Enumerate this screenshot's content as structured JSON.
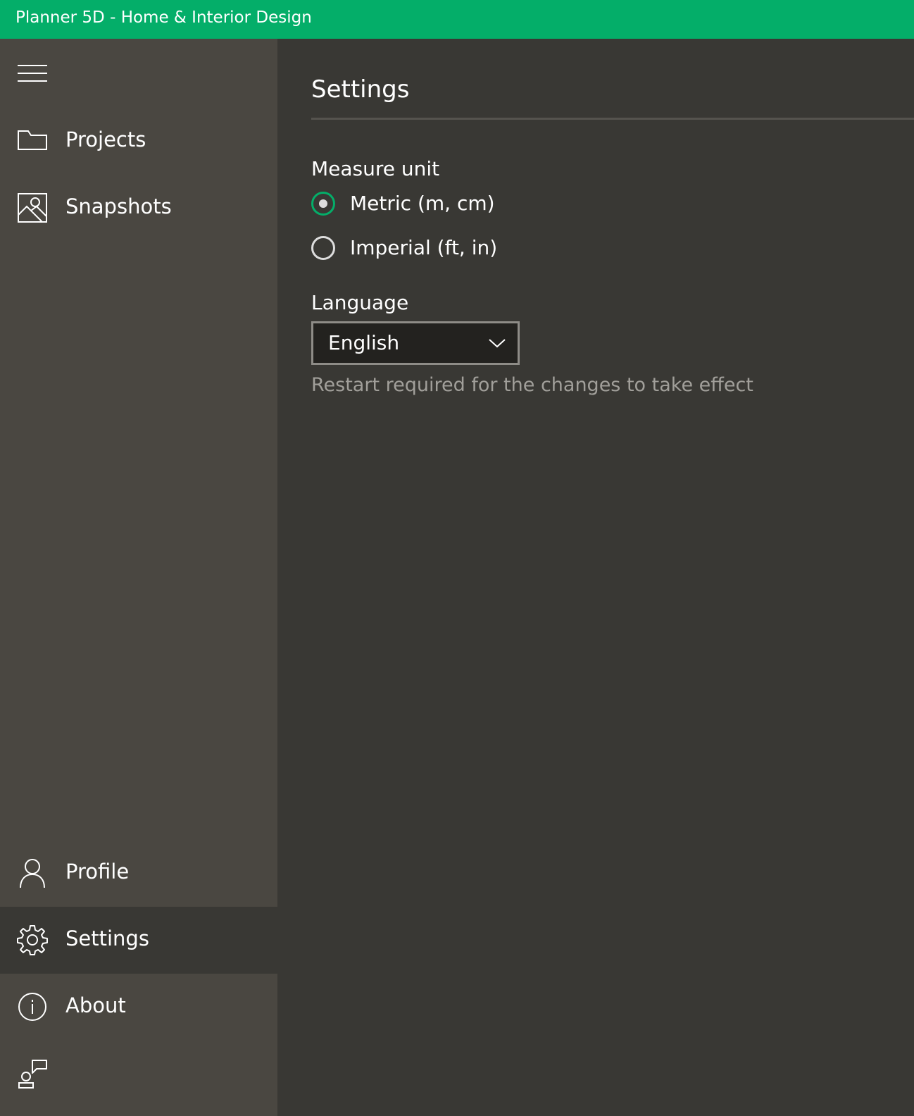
{
  "window": {
    "title": "Planner 5D - Home & Interior Design"
  },
  "colors": {
    "accent": "#04AE69",
    "sidebar_bg": "#4A4741",
    "main_bg": "#393834",
    "hint_text": "#A19F9A"
  },
  "sidebar": {
    "menu_icon": "hamburger-icon",
    "top_items": [
      {
        "label": "Projects",
        "icon": "folder-icon"
      },
      {
        "label": "Snapshots",
        "icon": "picture-icon"
      }
    ],
    "bottom_items": [
      {
        "label": "Profile",
        "icon": "person-icon"
      },
      {
        "label": "Settings",
        "icon": "gear-icon",
        "selected": true
      },
      {
        "label": "About",
        "icon": "info-icon"
      },
      {
        "label": "",
        "icon": "feedback-icon"
      }
    ]
  },
  "settings": {
    "title": "Settings",
    "measure_unit": {
      "label": "Measure unit",
      "options": [
        {
          "label": "Metric (m, cm)",
          "checked": true
        },
        {
          "label": "Imperial (ft, in)",
          "checked": false
        }
      ]
    },
    "language": {
      "label": "Language",
      "selected": "English",
      "hint": "Restart required for the changes to take effect"
    }
  }
}
